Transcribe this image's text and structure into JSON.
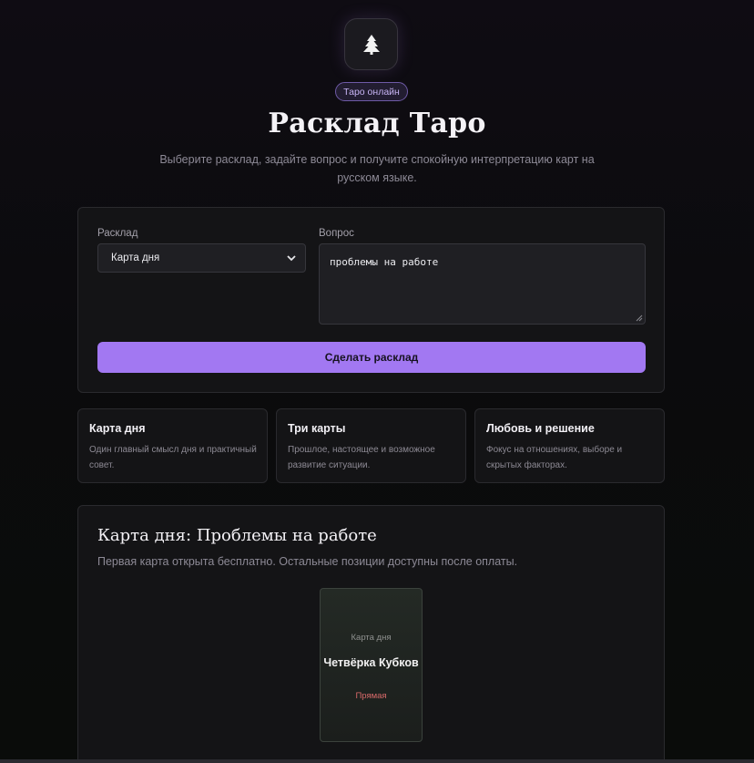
{
  "header": {
    "logo_icon": "tree-icon",
    "badge": "Таро онлайн",
    "title": "Расклад Таро",
    "subtitle": "Выберите расклад, задайте вопрос и получите спокойную интерпретацию карт на русском языке."
  },
  "form": {
    "spread_label": "Расклад",
    "spread_value": "Карта дня",
    "question_label": "Вопрос",
    "question_value": "проблемы на работе",
    "submit_label": "Сделать расклад"
  },
  "spreads": [
    {
      "title": "Карта дня",
      "description": "Один главный смысл дня и практичный совет."
    },
    {
      "title": "Три карты",
      "description": "Прошлое, настоящее и возможное развитие ситуации."
    },
    {
      "title": "Любовь и решение",
      "description": "Фокус на отношениях, выборе и скрытых факторах."
    }
  ],
  "result": {
    "title": "Карта дня: Проблемы на работе",
    "note": "Первая карта открыта бесплатно. Остальные позиции доступны после оплаты.",
    "card": {
      "position": "Карта дня",
      "name": "Четвёрка Кубков",
      "orientation": "Прямая"
    }
  },
  "colors": {
    "accent": "#a278f2",
    "orientation": "#d96a6a"
  }
}
